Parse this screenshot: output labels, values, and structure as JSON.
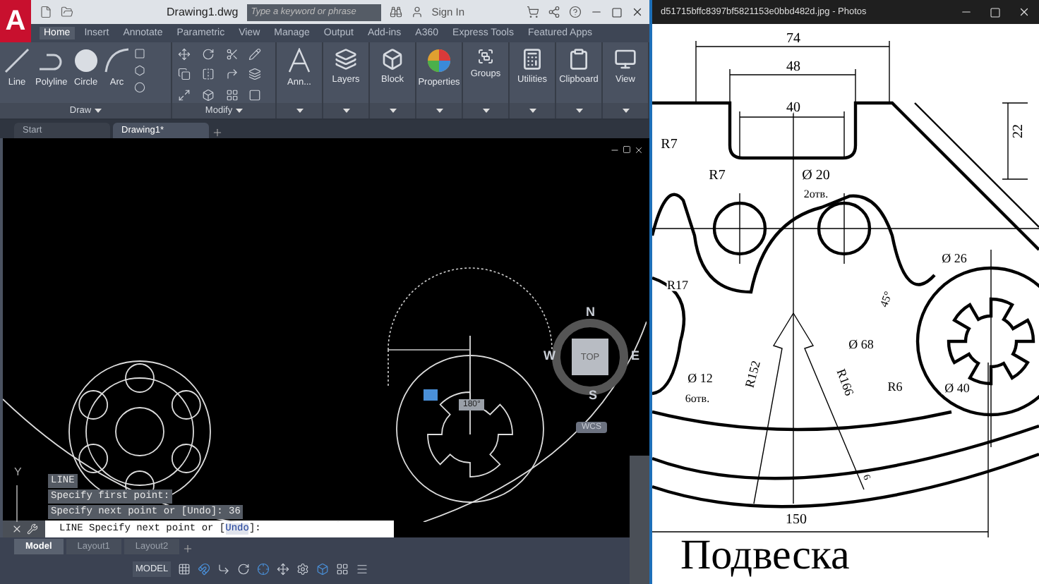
{
  "cad": {
    "logo": "A",
    "title": "Drawing1.dwg",
    "search": {
      "placeholder": "Type a keyword or phrase"
    },
    "sign_in": "Sign In",
    "ribbon_tabs": [
      {
        "label": "Home",
        "selected": true
      },
      {
        "label": "Insert",
        "selected": false
      },
      {
        "label": "Annotate",
        "selected": false
      },
      {
        "label": "Parametric",
        "selected": false
      },
      {
        "label": "View",
        "selected": false
      },
      {
        "label": "Manage",
        "selected": false
      },
      {
        "label": "Output",
        "selected": false
      },
      {
        "label": "Add-ins",
        "selected": false
      },
      {
        "label": "A360",
        "selected": false
      },
      {
        "label": "Express Tools",
        "selected": false
      },
      {
        "label": "Featured Apps",
        "selected": false
      }
    ],
    "draw_tools": [
      {
        "kind": "line",
        "label": "Line"
      },
      {
        "kind": "polyline",
        "label": "Polyline"
      },
      {
        "kind": "circle",
        "label": "Circle"
      },
      {
        "kind": "arc",
        "label": "Arc"
      }
    ],
    "group_labels": [
      "Draw",
      "Modify"
    ],
    "panels": [
      {
        "kind": "annotation",
        "label": "Ann..."
      },
      {
        "kind": "layers",
        "label": "Layers"
      },
      {
        "kind": "block",
        "label": "Block"
      },
      {
        "kind": "properties",
        "label": "Properties"
      },
      {
        "kind": "groups",
        "label": "Groups"
      },
      {
        "kind": "utilities",
        "label": "Utilities"
      },
      {
        "kind": "clipboard",
        "label": "Clipboard"
      },
      {
        "kind": "view",
        "label": "View"
      }
    ],
    "file_tabs": [
      {
        "label": "Start",
        "selected": false
      },
      {
        "label": "Drawing1*",
        "selected": true
      }
    ],
    "viewcube": {
      "north": "N",
      "west": "W",
      "east": "E",
      "south": "S",
      "face": "TOP",
      "ucs": "WCS"
    },
    "angle_label": "180°",
    "axis_label": "Y",
    "history": [
      "LINE",
      "Specify first point:",
      "Specify next point or [Undo]: 36"
    ],
    "command": {
      "prefix": "LINE Specify next point or [",
      "option": "Undo",
      "suffix": "]:"
    },
    "layout_tabs": [
      {
        "label": "Model",
        "selected": true
      },
      {
        "label": "Layout1",
        "selected": false
      },
      {
        "label": "Layout2",
        "selected": false
      }
    ],
    "status_mode": "MODEL"
  },
  "photos": {
    "title": "d51715bffc8397bf5821153e0bbd482d.jpg - Photos",
    "labels": [
      "74",
      "48",
      "40",
      "22",
      "R7",
      "R7",
      "Ø 20",
      "2отв.",
      "Ø 26",
      "45°",
      "R17",
      "Ø 68",
      "Ø 12",
      "6отв.",
      "R152",
      "R166",
      "R6",
      "Ø 40",
      "6",
      "150"
    ],
    "caption": "Подвеска"
  }
}
